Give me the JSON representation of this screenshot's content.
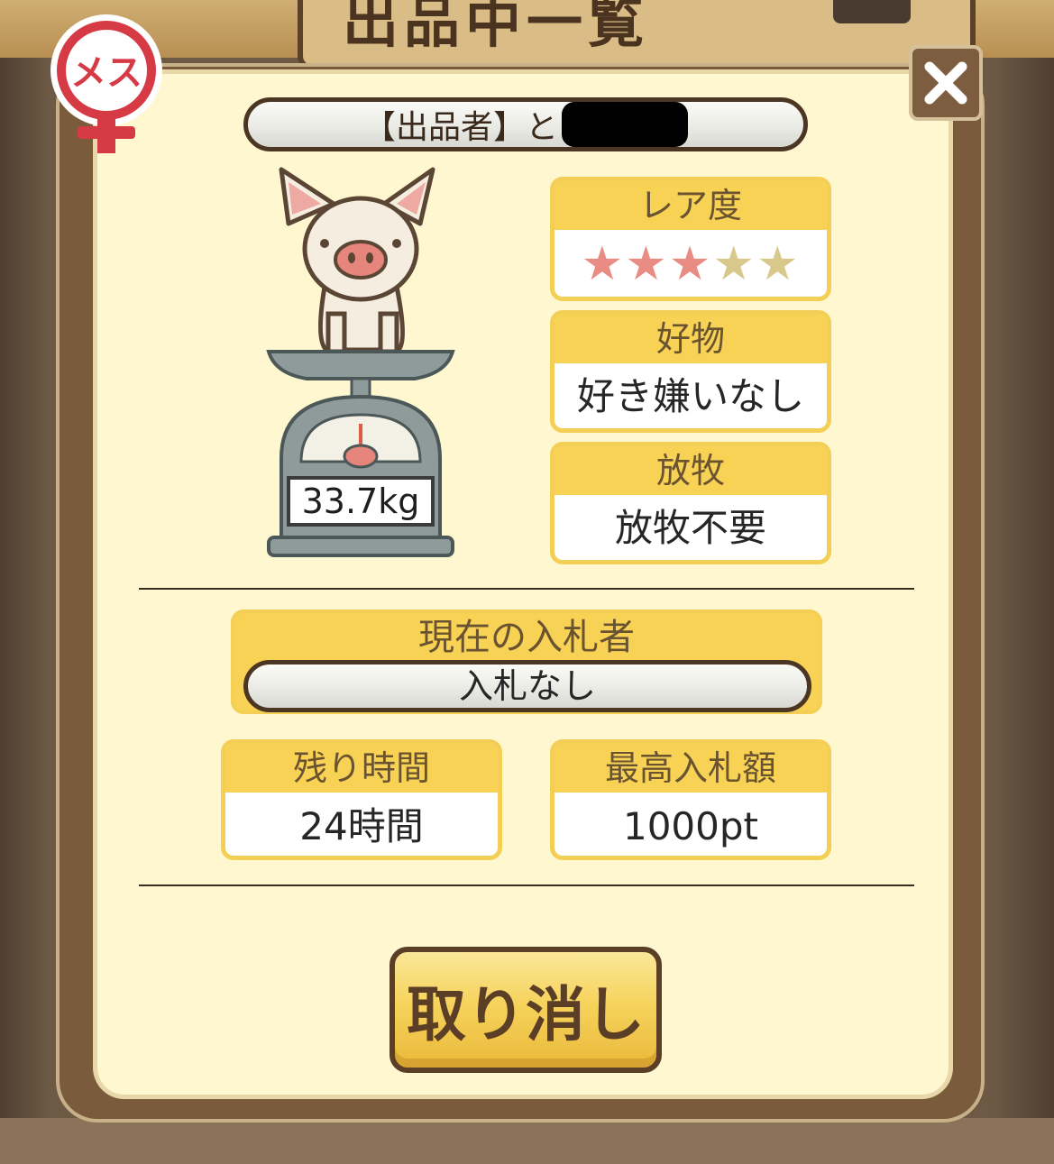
{
  "background": {
    "title": "出品中一覧"
  },
  "gender_badge": {
    "label": "メス"
  },
  "close_button": {
    "icon": "close-icon"
  },
  "seller": {
    "label": "【出品者】と"
  },
  "pig": {
    "weight": "33.7kg"
  },
  "rarity": {
    "header": "レア度",
    "stars_filled": 3,
    "stars_total": 5,
    "colors": {
      "filled": "#e88c84",
      "empty": "#d9c88c"
    }
  },
  "favorite_food": {
    "header": "好物",
    "value": "好き嫌いなし"
  },
  "grazing": {
    "header": "放牧",
    "value": "放牧不要"
  },
  "bidder": {
    "header": "現在の入札者",
    "value": "入札なし"
  },
  "time_left": {
    "header": "残り時間",
    "value": "24時間"
  },
  "highest_bid": {
    "header": "最高入札額",
    "value": "1000pt"
  },
  "cancel_button": {
    "label": "取り消し"
  },
  "colors": {
    "card_header": "#f7d254",
    "dialog_bg": "#fff7d0",
    "frame": "#7a5c3d",
    "badge_red": "#d63a45"
  }
}
